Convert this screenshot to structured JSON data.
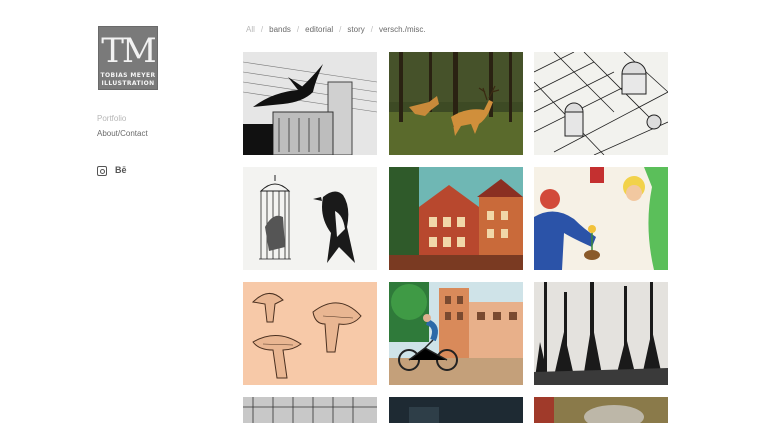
{
  "logo": {
    "mark": "TM",
    "line1": "TOBIAS MEYER",
    "line2": "ILLUSTRATION"
  },
  "nav": [
    {
      "label": "Portfolio",
      "active": true
    },
    {
      "label": "About/Contact",
      "active": false
    }
  ],
  "social": {
    "instagram": "instagram-icon",
    "behance_label": "Bē"
  },
  "filters": [
    {
      "label": "All",
      "active": true
    },
    {
      "label": "bands",
      "active": false
    },
    {
      "label": "editorial",
      "active": false
    },
    {
      "label": "story",
      "active": false
    },
    {
      "label": "versch./misc.",
      "active": false
    }
  ],
  "filter_separator": "/",
  "gallery": [
    {
      "subject": "crow-over-factory"
    },
    {
      "subject": "deer-in-forest"
    },
    {
      "subject": "city-aerial-drawing"
    },
    {
      "subject": "wolf-in-cage-and-magpie"
    },
    {
      "subject": "colorful-houses"
    },
    {
      "subject": "person-with-flower"
    },
    {
      "subject": "mushrooms-drawing"
    },
    {
      "subject": "cyclist-in-city"
    },
    {
      "subject": "dark-forest"
    },
    {
      "subject": "building-facade"
    },
    {
      "subject": "dark-night-scene"
    },
    {
      "subject": "animal-illustration"
    }
  ]
}
